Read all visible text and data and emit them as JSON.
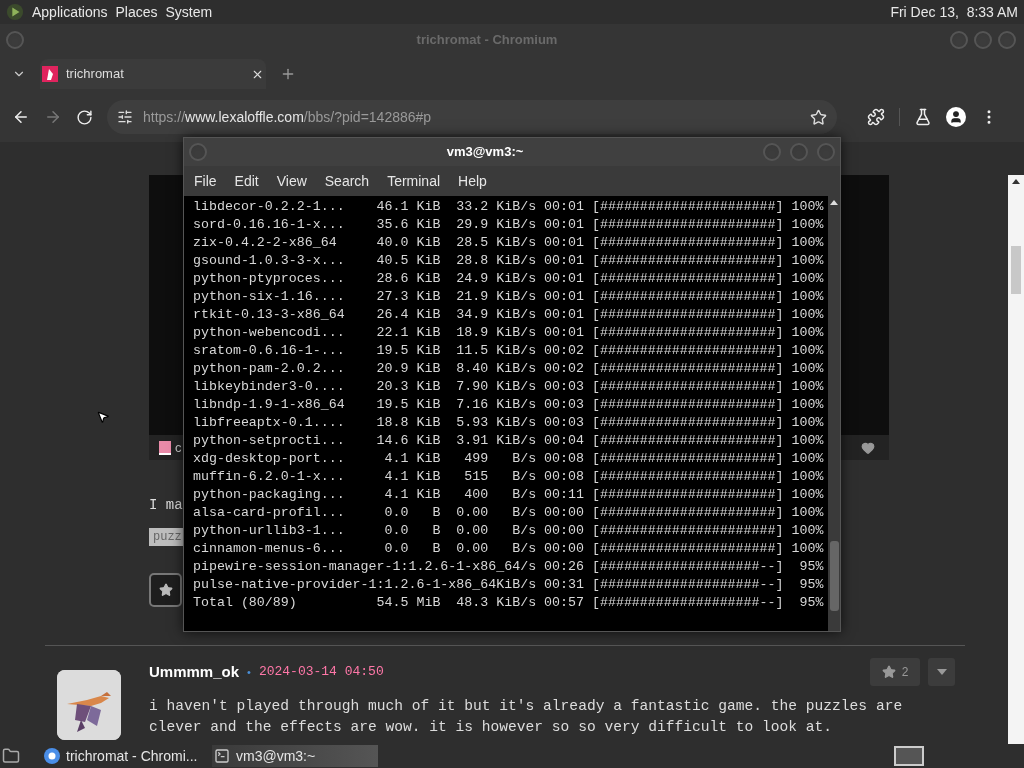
{
  "top_panel": {
    "menus": [
      "Applications",
      "Places",
      "System"
    ],
    "clock": "Fri Dec 13,  8:33 AM"
  },
  "browser": {
    "title": "trichromat - Chromium",
    "focused": false,
    "tabs": [
      {
        "label": "trichromat",
        "selected": true
      }
    ],
    "url": {
      "scheme": "https://",
      "host": "www.lexaloffle.com",
      "path": "/bbs/?pid=142886#p"
    },
    "forward_disabled": true,
    "page": {
      "post": {
        "cart_label": "c",
        "text": "I ma",
        "tags": [
          "puzz"
        ]
      },
      "comment": {
        "author": "Ummmm_ok",
        "separator": "•",
        "date": "2024-03-14 04:50",
        "likes": "2",
        "text": "i haven't played through much of it but it's already a fantastic game. the puzzles are clever and the effects are wow. it is however so so very difficult to look at."
      }
    }
  },
  "terminal": {
    "title": "vm3@vm3:~",
    "focused": true,
    "menus": [
      "File",
      "Edit",
      "View",
      "Search",
      "Terminal",
      "Help"
    ],
    "lines": [
      "libdecor-0.2.2-1...    46.1 KiB  33.2 KiB/s 00:01 [######################] 100%",
      "sord-0.16.16-1-x...    35.6 KiB  29.9 KiB/s 00:01 [######################] 100%",
      "zix-0.4.2-2-x86_64     40.0 KiB  28.5 KiB/s 00:01 [######################] 100%",
      "gsound-1.0.3-3-x...    40.5 KiB  28.8 KiB/s 00:01 [######################] 100%",
      "python-ptyproces...    28.6 KiB  24.9 KiB/s 00:01 [######################] 100%",
      "python-six-1.16....    27.3 KiB  21.9 KiB/s 00:01 [######################] 100%",
      "rtkit-0.13-3-x86_64    26.4 KiB  34.9 KiB/s 00:01 [######################] 100%",
      "python-webencodi...    22.1 KiB  18.9 KiB/s 00:01 [######################] 100%",
      "sratom-0.6.16-1-...    19.5 KiB  11.5 KiB/s 00:02 [######################] 100%",
      "python-pam-2.0.2...    20.9 KiB  8.40 KiB/s 00:02 [######################] 100%",
      "libkeybinder3-0....    20.3 KiB  7.90 KiB/s 00:03 [######################] 100%",
      "libndp-1.9-1-x86_64    19.5 KiB  7.16 KiB/s 00:03 [######################] 100%",
      "libfreeaptx-0.1....    18.8 KiB  5.93 KiB/s 00:03 [######################] 100%",
      "python-setprocti...    14.6 KiB  3.91 KiB/s 00:04 [######################] 100%",
      "xdg-desktop-port...     4.1 KiB   499   B/s 00:08 [######################] 100%",
      "muffin-6.2.0-1-x...     4.1 KiB   515   B/s 00:08 [######################] 100%",
      "python-packaging...     4.1 KiB   400   B/s 00:11 [######################] 100%",
      "alsa-card-profil...     0.0   B  0.00   B/s 00:00 [######################] 100%",
      "python-urllib3-1...     0.0   B  0.00   B/s 00:00 [######################] 100%",
      "cinnamon-menus-6...     0.0   B  0.00   B/s 00:00 [######################] 100%",
      "pipewire-session-manager-1:1.2.6-1-x86_64/s 00:26 [####################--]  95%",
      "pulse-native-provider-1:1.2.6-1-x86_64KiB/s 00:31 [####################--]  95%",
      "Total (80/89)          54.5 MiB  48.3 KiB/s 00:57 [####################--]  95%"
    ]
  },
  "taskbar": {
    "tasks": [
      {
        "kind": "browser",
        "label": "trichromat - Chromi...",
        "selected": false
      },
      {
        "kind": "terminal",
        "label": "vm3@vm3:~",
        "selected": true
      }
    ]
  }
}
